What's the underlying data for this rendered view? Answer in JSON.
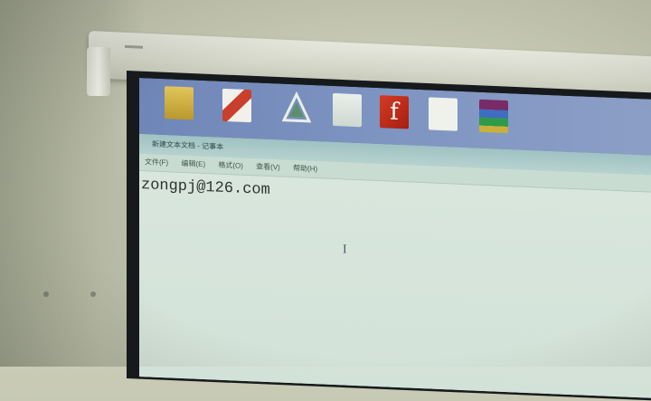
{
  "desktop": {
    "icons": [
      {
        "name": "folder-icon",
        "caption": ""
      },
      {
        "name": "app-red-icon",
        "caption": ""
      },
      {
        "name": "triangle-app-icon",
        "caption": ""
      },
      {
        "name": "dreamweaver-icon",
        "caption": ""
      },
      {
        "name": "flash-icon",
        "caption": "f"
      },
      {
        "name": "document-icon",
        "caption": ""
      },
      {
        "name": "winrar-icon",
        "caption": ""
      }
    ]
  },
  "window": {
    "title": "新建文本文档 - 记事本",
    "menu": [
      "文件(F)",
      "编辑(E)",
      "格式(O)",
      "查看(V)",
      "帮助(H)"
    ],
    "content_text": "zongpj@126.com",
    "cursor_glyph": "I"
  },
  "colors": {
    "desktop_bg": "#7f95c2",
    "titlebar": "#b6d2cf",
    "editor_bg": "#d8e6dd",
    "text": "#2c3331"
  }
}
